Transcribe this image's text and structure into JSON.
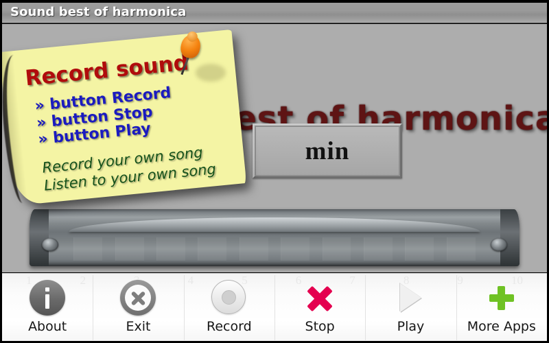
{
  "window": {
    "title": "Sound best of harmonica"
  },
  "stage": {
    "background_title": "Sound best of harmonica",
    "boxes": [
      {
        "label": ""
      },
      {
        "label": "min"
      }
    ],
    "instrument_icon": "harmonica-photo"
  },
  "note": {
    "title": "Record sound",
    "pin_icon": "orange-pushpin-icon",
    "bullets": [
      "» button Record",
      "» button Stop",
      "» button Play"
    ],
    "footer": [
      "Record your own song",
      "Listen to your own song"
    ]
  },
  "toolbar": {
    "watermark_numbers": [
      "1",
      "2",
      "3",
      "4",
      "5",
      "6",
      "7",
      "8",
      "9",
      "10"
    ],
    "items": [
      {
        "label": "About",
        "icon": "info-icon"
      },
      {
        "label": "Exit",
        "icon": "close-circle-icon"
      },
      {
        "label": "Record",
        "icon": "record-circle-icon"
      },
      {
        "label": "Stop",
        "icon": "cross-icon"
      },
      {
        "label": "Play",
        "icon": "play-triangle-icon"
      },
      {
        "label": "More Apps",
        "icon": "plus-icon"
      }
    ]
  },
  "colors": {
    "titlebar_gradient_top": "#9c9c9c",
    "stage_background": "#adadad",
    "note_paper": "#f4f4a4",
    "note_title": "#b00c0c",
    "note_bullet": "#1b1bbf",
    "note_footer": "#16521b",
    "bg_title": "#5e1414",
    "stop_accent": "#e4004f",
    "more_apps_accent": "#6fc224",
    "pin": "#f4820f"
  }
}
